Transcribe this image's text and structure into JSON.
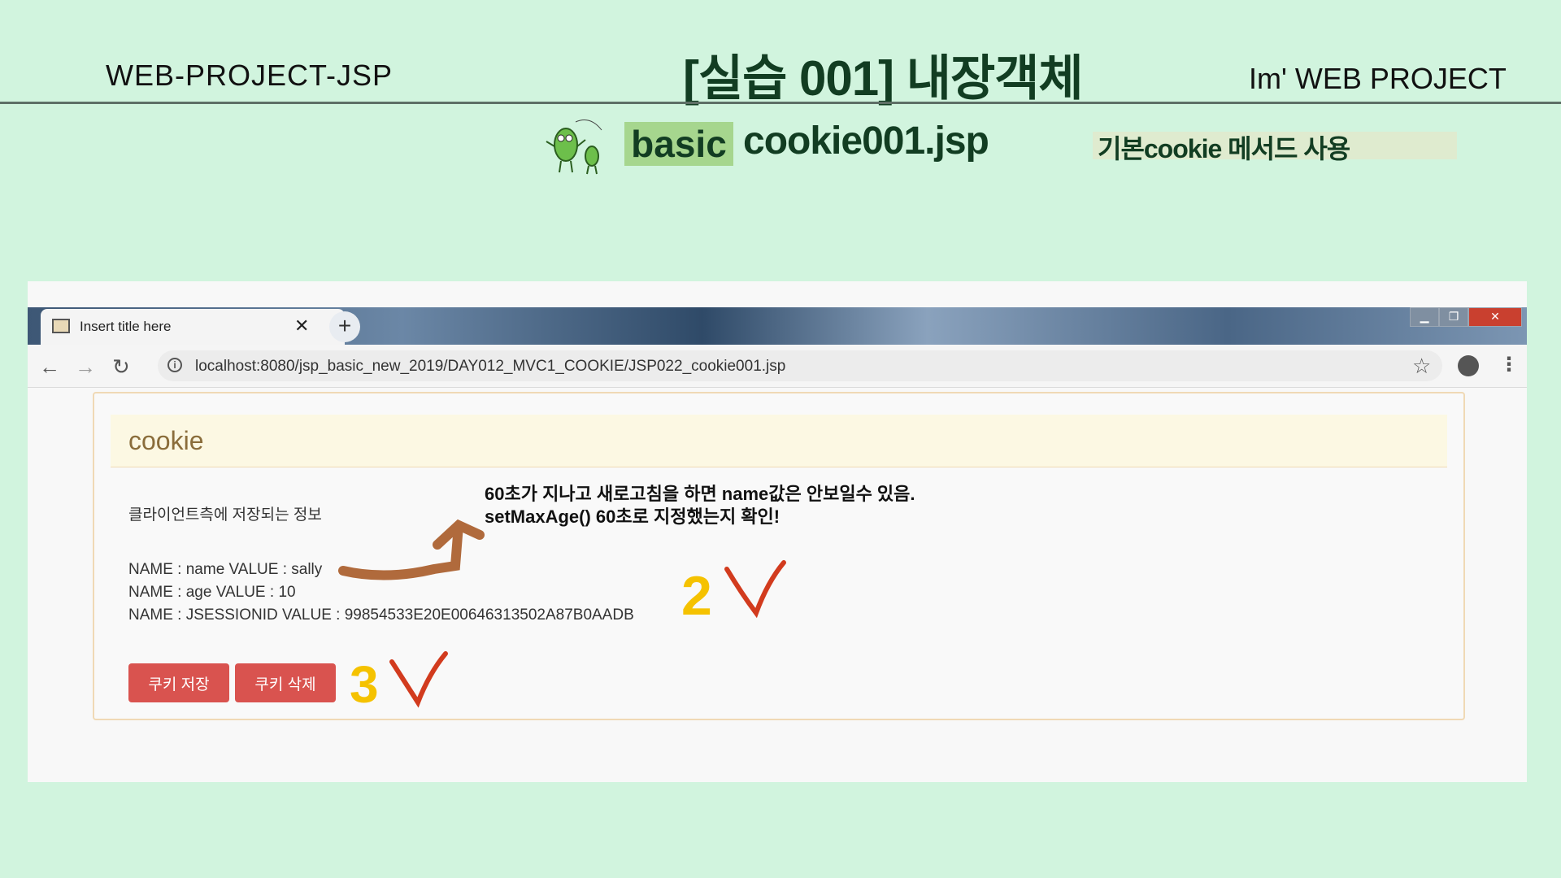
{
  "slide": {
    "left_label": "WEB-PROJECT-JSP",
    "title": "[실습 001]  내장객체",
    "right_label": "Im'  WEB PROJECT",
    "tag": "basic",
    "filename": "cookie001.jsp",
    "description": "기본cookie 메서드 사용"
  },
  "browser": {
    "tab_title": "Insert title here",
    "url": "localhost:8080/jsp_basic_new_2019/DAY012_MVC1_COOKIE/JSP022_cookie001.jsp"
  },
  "page": {
    "panel_title": "cookie",
    "client_info": "클라이언트측에 저장되는 정보",
    "note_line1": "60초가 지나고 새로고침을 하면 name값은 안보일수 있음.",
    "note_line2": "setMaxAge()  60초로 지정했는지 확인!",
    "cookies": [
      "NAME : name VALUE : sally",
      "NAME : age VALUE : 10",
      "NAME : JSESSIONID VALUE : 99854533E20E00646313502A87B0AADB"
    ],
    "save_button": "쿠키 저장",
    "delete_button": "쿠키 삭제"
  },
  "annotations": {
    "mark2": "2",
    "mark3": "3",
    "arrow_color": "#b06a3c",
    "number_color": "#f5c200",
    "check_color": "#d23b1e"
  }
}
